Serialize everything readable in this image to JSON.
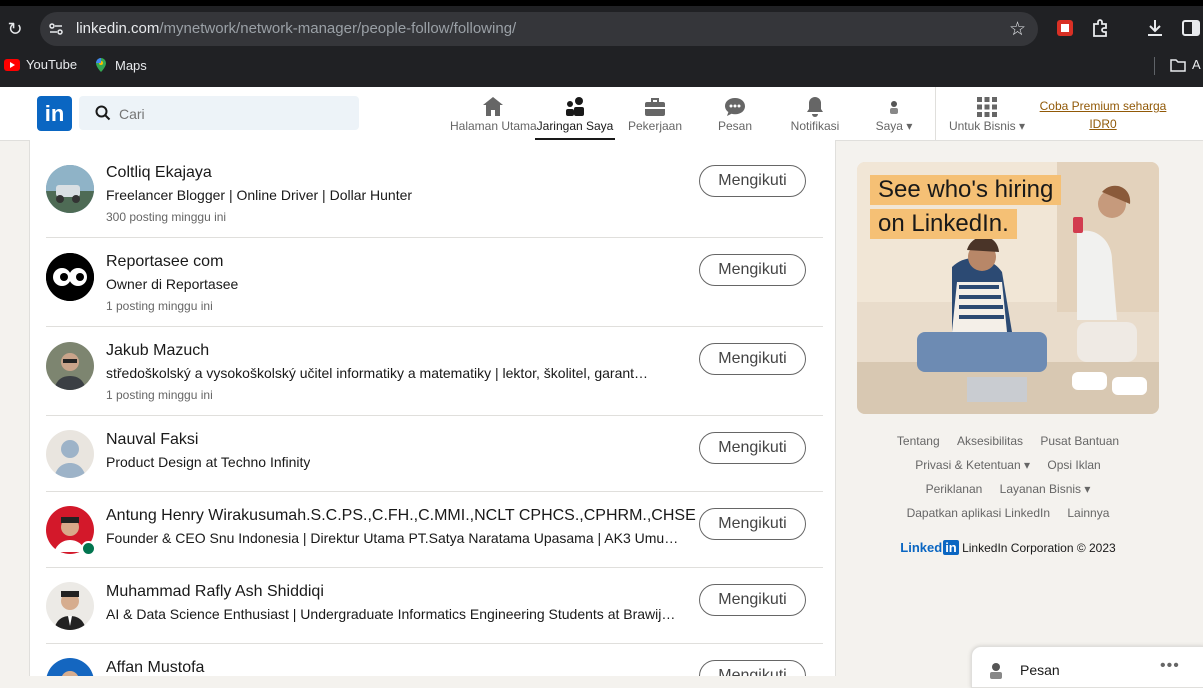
{
  "browser": {
    "url_host": "linkedin.com",
    "url_path": "/mynetwork/network-manager/people-follow/following/",
    "bookmarks": [
      {
        "label": "YouTube",
        "icon": "youtube-icon"
      },
      {
        "label": "Maps",
        "icon": "maps-icon"
      }
    ],
    "bookmarks_right_label": "A"
  },
  "header": {
    "logo": "in",
    "search_placeholder": "Cari",
    "nav": [
      {
        "label": "Halaman Utama",
        "icon": "home-icon"
      },
      {
        "label": "Jaringan Saya",
        "icon": "network-icon",
        "active": true
      },
      {
        "label": "Pekerjaan",
        "icon": "jobs-icon"
      },
      {
        "label": "Pesan",
        "icon": "messaging-icon"
      },
      {
        "label": "Notifikasi",
        "icon": "bell-icon"
      },
      {
        "label": "Saya",
        "icon": "me-avatar-icon"
      },
      {
        "label": "Untuk Bisnis",
        "icon": "grid-icon"
      }
    ],
    "premium_line1": "Coba Premium seharga",
    "premium_line2": "IDR0"
  },
  "following": [
    {
      "name": "Coltliq Ekajaya",
      "headline": "Freelancer Blogger | Online Driver | Dollar Hunter",
      "meta": "300 posting minggu ini",
      "button": "Mengikuti"
    },
    {
      "name": "Reportasee com",
      "headline": "Owner di Reportasee",
      "meta": "1 posting minggu ini",
      "button": "Mengikuti"
    },
    {
      "name": "Jakub Mazuch",
      "headline": "středoškolský a vysokoškolský učitel informatiky a matematiky | lektor, školitel, garant…",
      "meta": "1 posting minggu ini",
      "button": "Mengikuti"
    },
    {
      "name": "Nauval Faksi",
      "headline": "Product Design at Techno Infinity",
      "meta": "",
      "button": "Mengikuti"
    },
    {
      "name": "Antung Henry Wirakusumah.S.C.PS.,C.FH.,C.MMI.,NCLT CPHCS.,CPHRM.,CHSE",
      "headline": "Founder & CEO Snu Indonesia | Direktur Utama PT.Satya Naratama Upasama | AK3 Umum…",
      "meta": "",
      "button": "Mengikuti"
    },
    {
      "name": "Muhammad Rafly Ash Shiddiqi",
      "headline": "AI & Data Science Enthusiast | Undergraduate Informatics Engineering Students at Brawijay…",
      "meta": "",
      "button": "Mengikuti"
    },
    {
      "name": "Affan Mustofa",
      "headline": "",
      "meta": "",
      "button": "Mengikuti"
    }
  ],
  "ad": {
    "line1": "See who's hiring",
    "line2": "on LinkedIn."
  },
  "footer": {
    "row1": [
      "Tentang",
      "Aksesibilitas",
      "Pusat Bantuan"
    ],
    "row2": [
      "Privasi & Ketentuan ▾",
      "Opsi Iklan"
    ],
    "row3": [
      "Periklanan",
      "Layanan Bisnis ▾"
    ],
    "row4": [
      "Dapatkan aplikasi LinkedIn",
      "Lainnya"
    ],
    "brand": "Linked",
    "brand_in": "in",
    "copyright": "LinkedIn Corporation © 2023"
  },
  "messaging": {
    "label": "Pesan"
  },
  "colors": {
    "brand_blue": "#0a66c2",
    "premium": "#915907",
    "ad_highlight": "#f5c075"
  }
}
